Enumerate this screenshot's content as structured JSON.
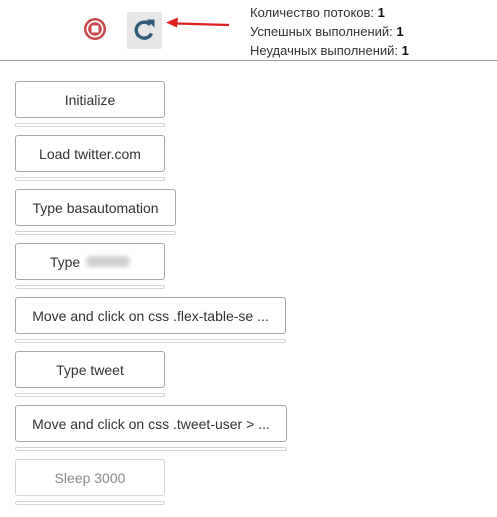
{
  "header": {
    "stop_icon": "stop-circle-icon",
    "refresh_icon": "refresh-icon",
    "arrow_icon": "red-arrow-left-icon",
    "stats": {
      "threads_label": "Количество потоков: ",
      "threads_value": "1",
      "success_label": "Успешных выполнений: ",
      "success_value": "1",
      "fail_label": "Неудачных выполнений: ",
      "fail_value": "1"
    },
    "colors": {
      "stop": "#c0392b",
      "refresh_glyph": "#2f5d7c",
      "arrow": "#e02020"
    }
  },
  "steps": [
    {
      "label": "Initialize",
      "state": "done"
    },
    {
      "label": "Load twitter.com",
      "state": "done"
    },
    {
      "label": "Type basautomation",
      "state": "done"
    },
    {
      "label": "Type",
      "state": "done",
      "redacted": true
    },
    {
      "label": "Move and click on css .flex-table-se ...",
      "state": "done"
    },
    {
      "label": "Type tweet",
      "state": "done"
    },
    {
      "label": "Move and click on css .tweet-user > ...",
      "state": "done"
    },
    {
      "label": "Sleep 3000",
      "state": "disabled"
    }
  ]
}
